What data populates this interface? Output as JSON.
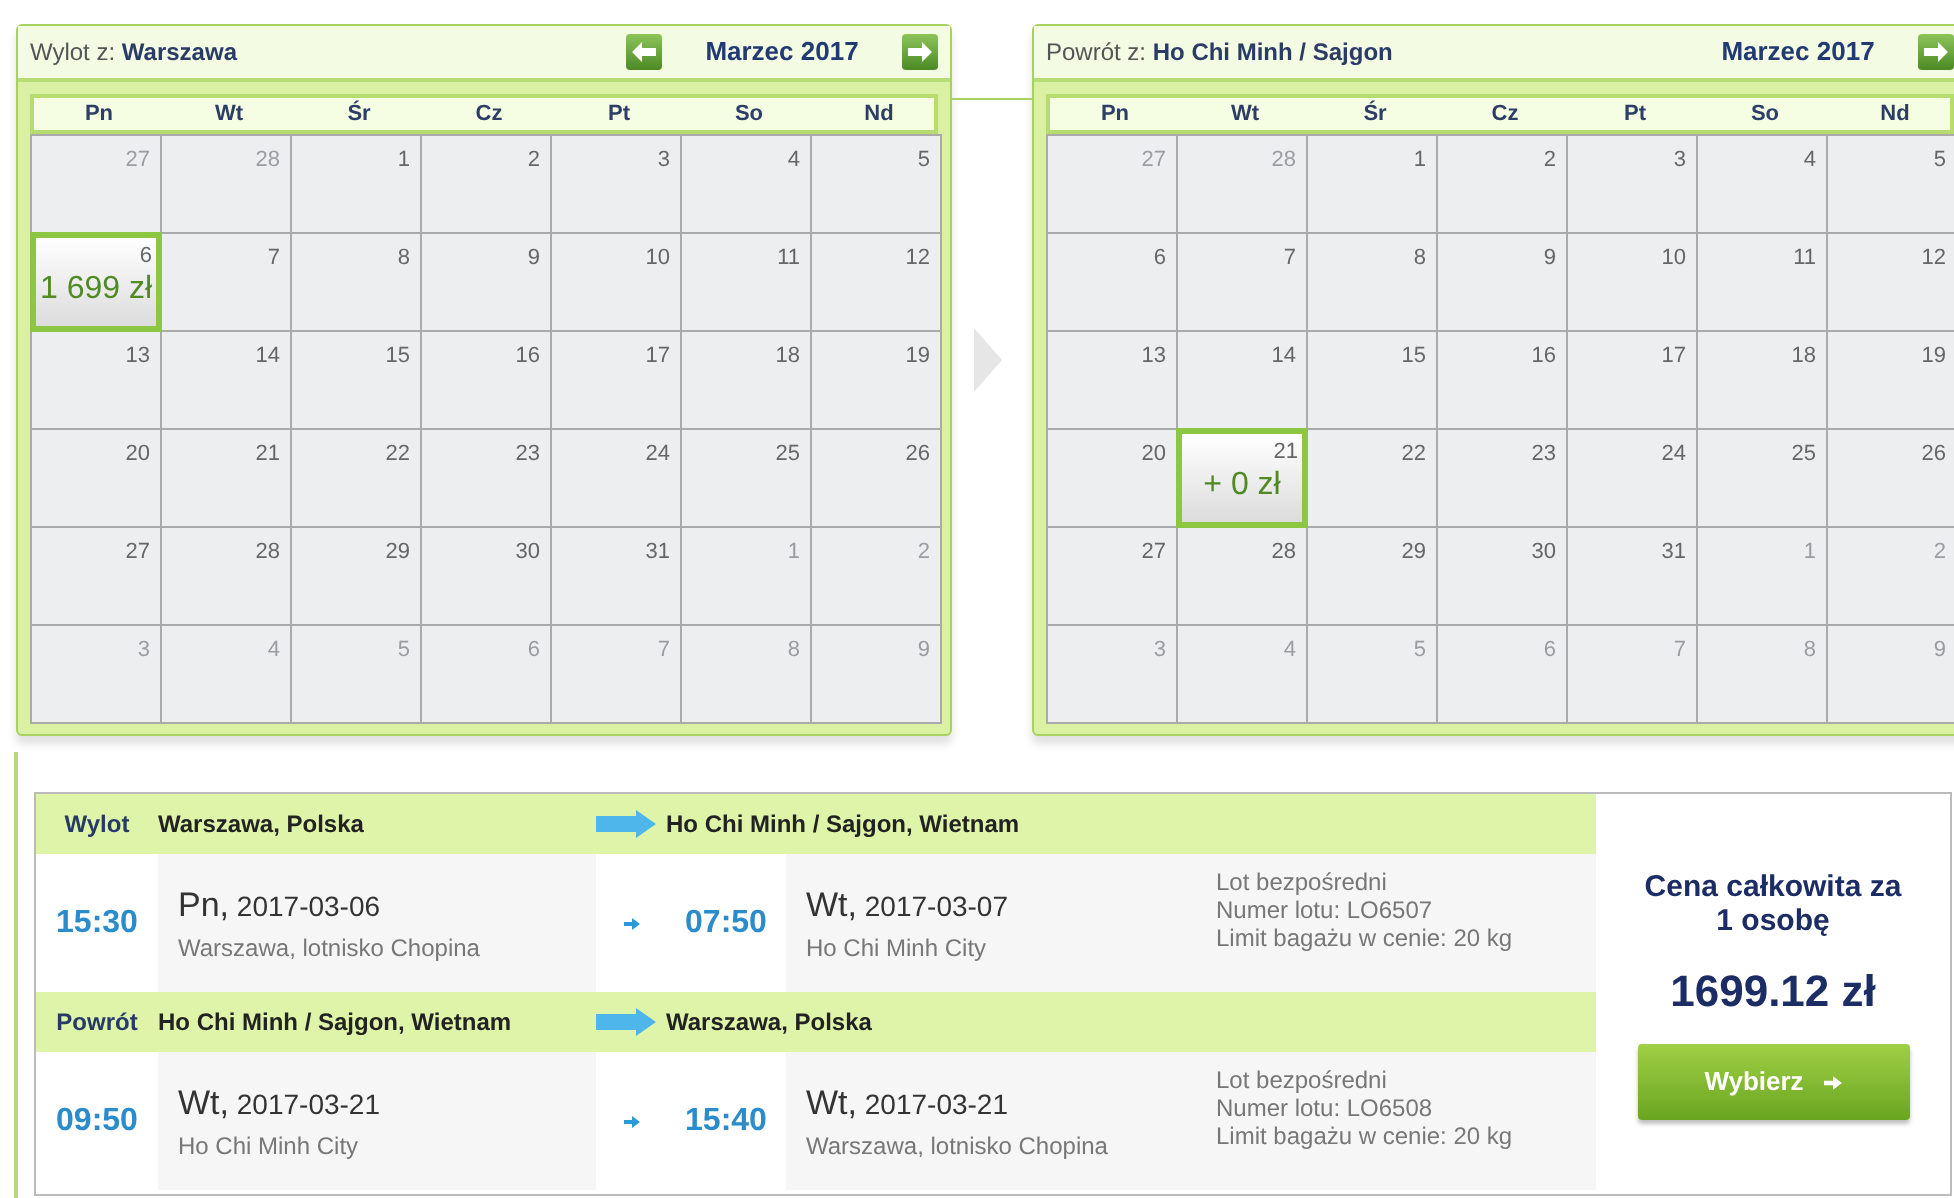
{
  "calendars": [
    {
      "title": "Wylot z: **Warszawa**",
      "month": "Marzec 2017",
      "prev_button": true,
      "next_button": true,
      "weekdays": [
        "Pn",
        "Wt",
        "Śr",
        "Cz",
        "Pt",
        "So",
        "Nd"
      ],
      "weeks": [
        [
          {
            "day": "27",
            "other_month": true,
            "selected": false
          },
          {
            "day": "28",
            "other_month": true,
            "selected": false
          },
          {
            "day": "1",
            "other_month": false,
            "selected": false
          },
          {
            "day": "2",
            "other_month": false,
            "selected": false
          },
          {
            "day": "3",
            "other_month": false,
            "selected": false
          },
          {
            "day": "4",
            "other_month": false,
            "selected": false
          },
          {
            "day": "5",
            "other_month": false,
            "selected": false
          }
        ],
        [
          {
            "day": "6",
            "other_month": false,
            "selected": true,
            "price": "1 699 zł"
          },
          {
            "day": "7",
            "other_month": false,
            "selected": false
          },
          {
            "day": "8",
            "other_month": false,
            "selected": false
          },
          {
            "day": "9",
            "other_month": false,
            "selected": false
          },
          {
            "day": "10",
            "other_month": false,
            "selected": false
          },
          {
            "day": "11",
            "other_month": false,
            "selected": false
          },
          {
            "day": "12",
            "other_month": false,
            "selected": false
          }
        ],
        [
          {
            "day": "13",
            "other_month": false,
            "selected": false
          },
          {
            "day": "14",
            "other_month": false,
            "selected": false
          },
          {
            "day": "15",
            "other_month": false,
            "selected": false
          },
          {
            "day": "16",
            "other_month": false,
            "selected": false
          },
          {
            "day": "17",
            "other_month": false,
            "selected": false
          },
          {
            "day": "18",
            "other_month": false,
            "selected": false
          },
          {
            "day": "19",
            "other_month": false,
            "selected": false
          }
        ],
        [
          {
            "day": "20",
            "other_month": false,
            "selected": false
          },
          {
            "day": "21",
            "other_month": false,
            "selected": false
          },
          {
            "day": "22",
            "other_month": false,
            "selected": false
          },
          {
            "day": "23",
            "other_month": false,
            "selected": false
          },
          {
            "day": "24",
            "other_month": false,
            "selected": false
          },
          {
            "day": "25",
            "other_month": false,
            "selected": false
          },
          {
            "day": "26",
            "other_month": false,
            "selected": false
          }
        ],
        [
          {
            "day": "27",
            "other_month": false,
            "selected": false
          },
          {
            "day": "28",
            "other_month": false,
            "selected": false
          },
          {
            "day": "29",
            "other_month": false,
            "selected": false
          },
          {
            "day": "30",
            "other_month": false,
            "selected": false
          },
          {
            "day": "31",
            "other_month": false,
            "selected": false
          },
          {
            "day": "1",
            "other_month": true,
            "selected": false
          },
          {
            "day": "2",
            "other_month": true,
            "selected": false
          }
        ],
        [
          {
            "day": "3",
            "other_month": true,
            "selected": false
          },
          {
            "day": "4",
            "other_month": true,
            "selected": false
          },
          {
            "day": "5",
            "other_month": true,
            "selected": false
          },
          {
            "day": "6",
            "other_month": true,
            "selected": false
          },
          {
            "day": "7",
            "other_month": true,
            "selected": false
          },
          {
            "day": "8",
            "other_month": true,
            "selected": false
          },
          {
            "day": "9",
            "other_month": true,
            "selected": false
          }
        ]
      ]
    },
    {
      "title": "Powrót z: **Ho Chi Minh / Sajgon**",
      "month": "Marzec 2017",
      "prev_button": false,
      "next_button": true,
      "weekdays": [
        "Pn",
        "Wt",
        "Śr",
        "Cz",
        "Pt",
        "So",
        "Nd"
      ],
      "weeks": [
        [
          {
            "day": "27",
            "other_month": true,
            "selected": false
          },
          {
            "day": "28",
            "other_month": true,
            "selected": false
          },
          {
            "day": "1",
            "other_month": false,
            "selected": false
          },
          {
            "day": "2",
            "other_month": false,
            "selected": false
          },
          {
            "day": "3",
            "other_month": false,
            "selected": false
          },
          {
            "day": "4",
            "other_month": false,
            "selected": false
          },
          {
            "day": "5",
            "other_month": false,
            "selected": false
          }
        ],
        [
          {
            "day": "6",
            "other_month": false,
            "selected": false
          },
          {
            "day": "7",
            "other_month": false,
            "selected": false
          },
          {
            "day": "8",
            "other_month": false,
            "selected": false
          },
          {
            "day": "9",
            "other_month": false,
            "selected": false
          },
          {
            "day": "10",
            "other_month": false,
            "selected": false
          },
          {
            "day": "11",
            "other_month": false,
            "selected": false
          },
          {
            "day": "12",
            "other_month": false,
            "selected": false
          }
        ],
        [
          {
            "day": "13",
            "other_month": false,
            "selected": false
          },
          {
            "day": "14",
            "other_month": false,
            "selected": false
          },
          {
            "day": "15",
            "other_month": false,
            "selected": false
          },
          {
            "day": "16",
            "other_month": false,
            "selected": false
          },
          {
            "day": "17",
            "other_month": false,
            "selected": false
          },
          {
            "day": "18",
            "other_month": false,
            "selected": false
          },
          {
            "day": "19",
            "other_month": false,
            "selected": false
          }
        ],
        [
          {
            "day": "20",
            "other_month": false,
            "selected": false
          },
          {
            "day": "21",
            "other_month": false,
            "selected": true,
            "price": "+ 0 zł"
          },
          {
            "day": "22",
            "other_month": false,
            "selected": false
          },
          {
            "day": "23",
            "other_month": false,
            "selected": false
          },
          {
            "day": "24",
            "other_month": false,
            "selected": false
          },
          {
            "day": "25",
            "other_month": false,
            "selected": false
          },
          {
            "day": "26",
            "other_month": false,
            "selected": false
          }
        ],
        [
          {
            "day": "27",
            "other_month": false,
            "selected": false
          },
          {
            "day": "28",
            "other_month": false,
            "selected": false
          },
          {
            "day": "29",
            "other_month": false,
            "selected": false
          },
          {
            "day": "30",
            "other_month": false,
            "selected": false
          },
          {
            "day": "31",
            "other_month": false,
            "selected": false
          },
          {
            "day": "1",
            "other_month": true,
            "selected": false
          },
          {
            "day": "2",
            "other_month": true,
            "selected": false
          }
        ],
        [
          {
            "day": "3",
            "other_month": true,
            "selected": false
          },
          {
            "day": "4",
            "other_month": true,
            "selected": false
          },
          {
            "day": "5",
            "other_month": true,
            "selected": false
          },
          {
            "day": "6",
            "other_month": true,
            "selected": false
          },
          {
            "day": "7",
            "other_month": true,
            "selected": false
          },
          {
            "day": "8",
            "other_month": true,
            "selected": false
          },
          {
            "day": "9",
            "other_month": true,
            "selected": false
          }
        ]
      ]
    }
  ],
  "flights": [
    {
      "label": "Wylot",
      "from": "Warszawa, Polska",
      "to": "Ho Chi Minh / Sajgon, Wietnam",
      "dep_time": "15:30",
      "dep_weekday": "Pn,",
      "dep_date": "2017-03-06",
      "dep_place": "Warszawa, lotnisko Chopina",
      "arr_time": "07:50",
      "arr_weekday": "Wt,",
      "arr_date": "2017-03-07",
      "arr_place": "Ho Chi Minh City",
      "info": [
        "Lot bezpośredni",
        "Numer lotu: LO6507",
        "Limit bagażu w cenie: 20 kg"
      ]
    },
    {
      "label": "Powrót",
      "from": "Ho Chi Minh / Sajgon, Wietnam",
      "to": "Warszawa, Polska",
      "dep_time": "09:50",
      "dep_weekday": "Wt,",
      "dep_date": "2017-03-21",
      "dep_place": "Ho Chi Minh City",
      "arr_time": "15:40",
      "arr_weekday": "Wt,",
      "arr_date": "2017-03-21",
      "arr_place": "Warszawa, lotnisko Chopina",
      "info": [
        "Lot bezpośredni",
        "Numer lotu: LO6508",
        "Limit bagażu w cenie: 20 kg"
      ]
    }
  ],
  "price": {
    "label": "Cena całkowita za 1 osobę",
    "amount": "1699.12 zł",
    "button": "Wybierz"
  }
}
